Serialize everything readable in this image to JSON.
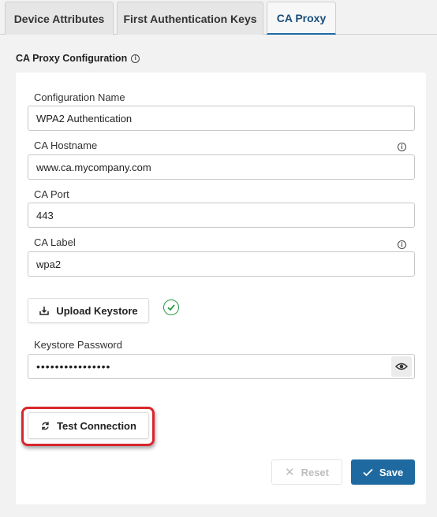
{
  "tabs": [
    {
      "label": "Device Attributes"
    },
    {
      "label": "First Authentication Keys"
    },
    {
      "label": "CA Proxy"
    }
  ],
  "section": {
    "title": "CA Proxy Configuration"
  },
  "fields": {
    "config_name": {
      "label": "Configuration Name",
      "value": "WPA2 Authentication"
    },
    "ca_hostname": {
      "label": "CA Hostname",
      "value": "www.ca.mycompany.com"
    },
    "ca_port": {
      "label": "CA Port",
      "value": "443"
    },
    "ca_label": {
      "label": "CA Label",
      "value": "wpa2"
    },
    "keystore_password": {
      "label": "Keystore Password",
      "value": "••••••••••••••••"
    }
  },
  "buttons": {
    "upload_keystore": "Upload Keystore",
    "test_connection": "Test Connection",
    "reset": "Reset",
    "save": "Save"
  },
  "colors": {
    "accent": "#1e6aa0",
    "success": "#2b9a45",
    "highlight": "#d9262c"
  }
}
